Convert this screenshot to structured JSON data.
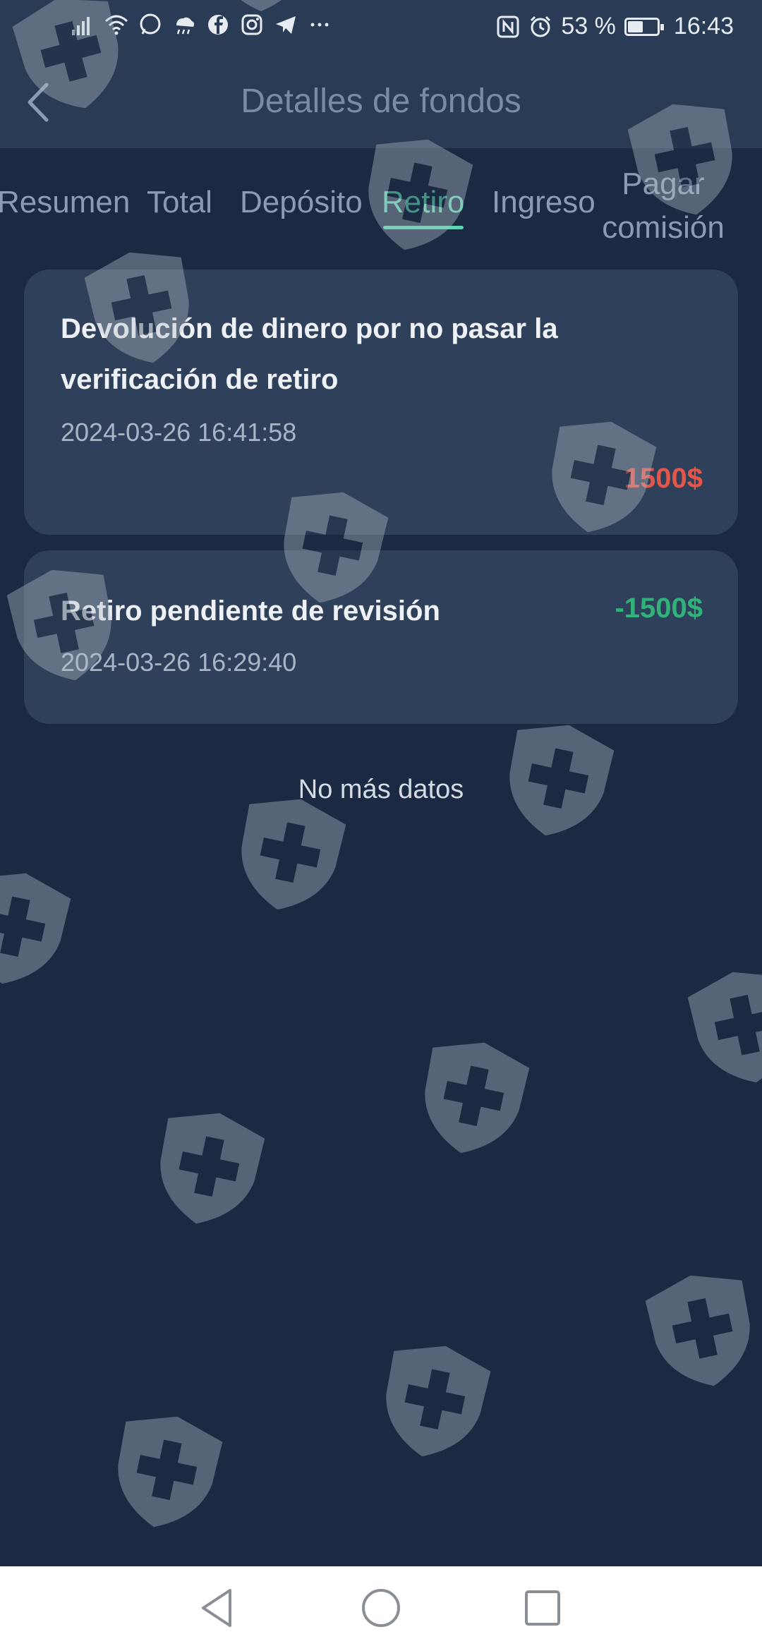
{
  "status_bar": {
    "battery_percent": "53 %",
    "battery_level": 0.53,
    "time": "16:43",
    "left_icons": [
      "signal-icon",
      "wifi-icon",
      "whatsapp-icon",
      "weather-icon",
      "facebook-icon",
      "instagram-icon",
      "telegram-icon",
      "more-dots-icon"
    ],
    "right_icons": [
      "nfc-icon",
      "alarm-icon",
      "battery-icon"
    ]
  },
  "header": {
    "title": "Detalles de fondos",
    "back_icon": "chevron-left-icon"
  },
  "tabs": [
    {
      "label": "Resumen",
      "active": false
    },
    {
      "label": "Total",
      "active": false
    },
    {
      "label": "Depósito",
      "active": false
    },
    {
      "label": "Retiro",
      "active": true
    },
    {
      "label": "Ingreso",
      "active": false
    },
    {
      "label": "Pagar comisión",
      "active": false
    }
  ],
  "records": [
    {
      "title": "Devolución de dinero por no pasar la verificación de retiro",
      "time": "2024-03-26 16:41:58",
      "amount": "1500$",
      "amount_color": "#e4564a"
    },
    {
      "title": "Retiro pendiente de revisión",
      "time": "2024-03-26 16:29:40",
      "amount": "-1500$",
      "amount_color": "#31b27a"
    }
  ],
  "footer_text": "No más datos",
  "nav_bar": {
    "icons": [
      "back-triangle-icon",
      "home-circle-icon",
      "recents-square-icon"
    ]
  },
  "colors": {
    "background": "#1b2a42",
    "header": "#2a3b55",
    "card": "#2f405a",
    "accent": "#5fd2b1"
  }
}
